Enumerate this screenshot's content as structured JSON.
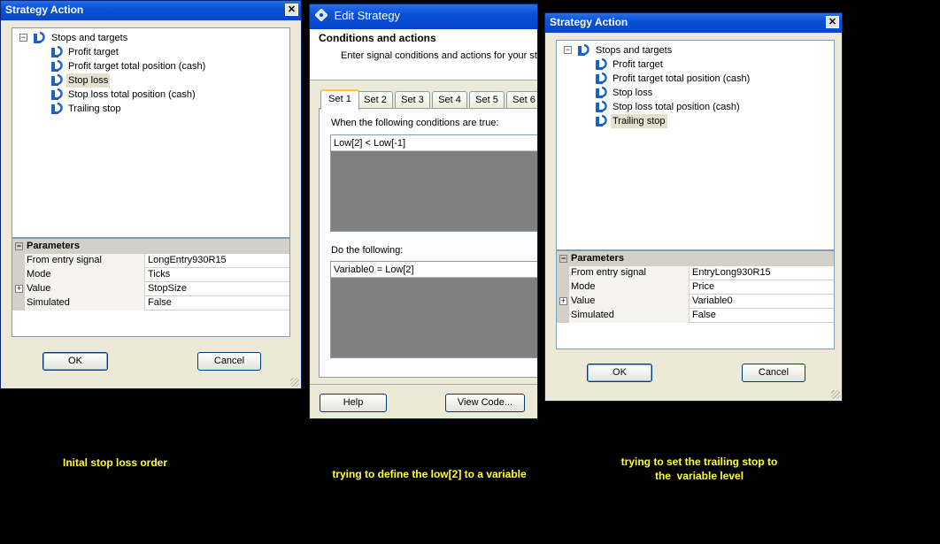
{
  "window1": {
    "title": "Strategy Action",
    "tree": {
      "root": "Stops and targets",
      "items": [
        "Profit target",
        "Profit target total position (cash)",
        "Stop loss",
        "Stop loss total position (cash)",
        "Trailing stop"
      ],
      "selected_index": 2
    },
    "params": {
      "header": "Parameters",
      "rows": [
        {
          "name": "From entry signal",
          "value": "LongEntry930R15"
        },
        {
          "name": "Mode",
          "value": "Ticks"
        },
        {
          "name": "Value",
          "value": "StopSize"
        },
        {
          "name": "Simulated",
          "value": "False"
        }
      ]
    },
    "ok_label": "OK",
    "cancel_label": "Cancel"
  },
  "window2": {
    "title": "Edit Strategy",
    "header_title": "Conditions and actions",
    "header_desc": "Enter signal conditions and actions for your stra",
    "tabs": [
      "Set 1",
      "Set 2",
      "Set 3",
      "Set 4",
      "Set 5",
      "Set 6"
    ],
    "active_tab": 0,
    "conditions_label": "When the following conditions are true:",
    "condition": "Low[2] < Low[-1]",
    "actions_label": "Do the following:",
    "action": "Variable0 = Low[2]",
    "help_label": "Help",
    "viewcode_label": "View Code..."
  },
  "window3": {
    "title": "Strategy Action",
    "tree": {
      "root": "Stops and targets",
      "items": [
        "Profit target",
        "Profit target total position (cash)",
        "Stop loss",
        "Stop loss total position (cash)",
        "Trailing stop"
      ],
      "selected_index": 4
    },
    "params": {
      "header": "Parameters",
      "rows": [
        {
          "name": "From entry signal",
          "value": "EntryLong930R15"
        },
        {
          "name": "Mode",
          "value": "Price"
        },
        {
          "name": "Value",
          "value": "Variable0"
        },
        {
          "name": "Simulated",
          "value": "False"
        }
      ]
    },
    "ok_label": "OK",
    "cancel_label": "Cancel"
  },
  "captions": {
    "left": "Inital stop loss order",
    "middle": "trying to define the low[2] to a variable",
    "right_line1": "trying to set the trailing stop to",
    "right_line2": "the  variable level"
  },
  "colors": {
    "titlebar": "#0851d8",
    "caption": "#ffff33",
    "dialog_bg": "#ece9d8"
  }
}
